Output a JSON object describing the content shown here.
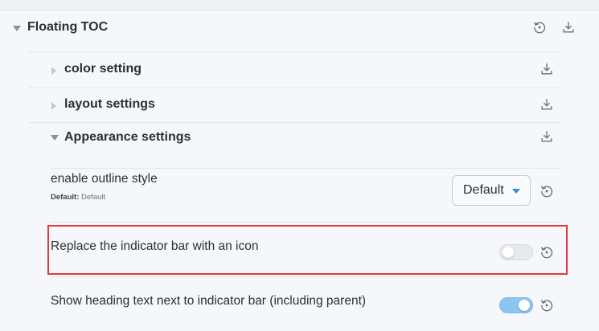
{
  "section": {
    "title": "Floating TOC",
    "reset_icon": "reset-icon",
    "download_icon": "download-icon"
  },
  "subsections": [
    {
      "label": "color setting",
      "expanded": false,
      "icon": "download-icon"
    },
    {
      "label": "layout settings",
      "expanded": false,
      "icon": "download-icon"
    },
    {
      "label": "Appearance settings",
      "expanded": true,
      "icon": "download-icon"
    }
  ],
  "settings": {
    "outline_style": {
      "label": "enable outline style",
      "default_key": "Default:",
      "default_value": "Default",
      "selected": "Default"
    },
    "replace_indicator": {
      "label": "Replace the indicator bar with an icon",
      "enabled": false
    },
    "show_heading_text": {
      "label": "Show heading text next to indicator bar (including parent)",
      "enabled": true
    }
  },
  "colors": {
    "highlight": "#e0393e",
    "toggle_on": "#8cc4f2",
    "select_arrow": "#2e8ae6"
  }
}
